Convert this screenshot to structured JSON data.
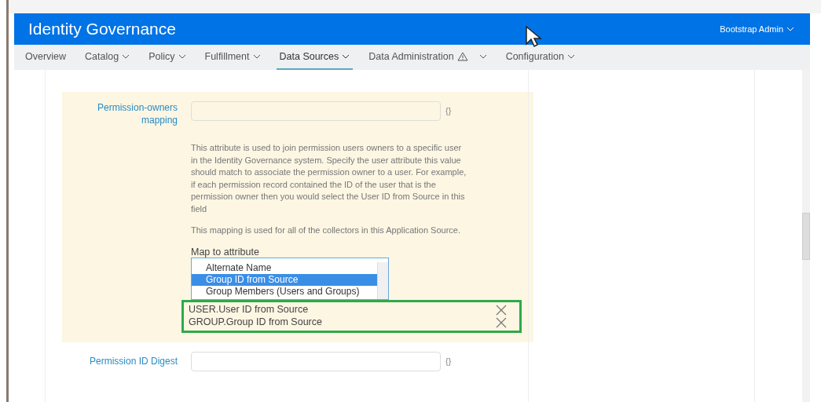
{
  "header": {
    "title": "Identity Governance",
    "user_menu": "Bootstrap Admin"
  },
  "nav": [
    {
      "label": "Overview",
      "dropdown": false,
      "warning": false,
      "selected": false
    },
    {
      "label": "Catalog",
      "dropdown": true,
      "warning": false,
      "selected": false
    },
    {
      "label": "Policy",
      "dropdown": true,
      "warning": false,
      "selected": false
    },
    {
      "label": "Fulfillment",
      "dropdown": true,
      "warning": false,
      "selected": false
    },
    {
      "label": "Data Sources",
      "dropdown": true,
      "warning": false,
      "selected": true
    },
    {
      "label": "Data Administration",
      "dropdown": true,
      "warning": true,
      "selected": false
    },
    {
      "label": "Configuration",
      "dropdown": true,
      "warning": false,
      "selected": false
    }
  ],
  "permission_owners": {
    "label": "Permission-owners mapping",
    "suffix": "{}",
    "help": [
      "This attribute is used to join permission users owners to a specific user in the Identity Governance system. Specify the user attribute this value should match to associate the permission owner to a user. For example, if each permission record contained the ID of the user that is the permission owner then you would select the User ID from Source in this field",
      "This mapping is used for all of the collectors in this Application Source."
    ],
    "map_label": "Map to attribute",
    "options": [
      {
        "label": "Alternate Name",
        "selected": false
      },
      {
        "label": "Group ID from Source",
        "selected": true
      },
      {
        "label": "Group Members (Users and Groups)",
        "selected": false
      }
    ],
    "mappings": [
      "USER.User ID from Source",
      "GROUP.Group ID from Source"
    ]
  },
  "permission_id_digest": {
    "label": "Permission ID Digest",
    "suffix": "{}"
  }
}
